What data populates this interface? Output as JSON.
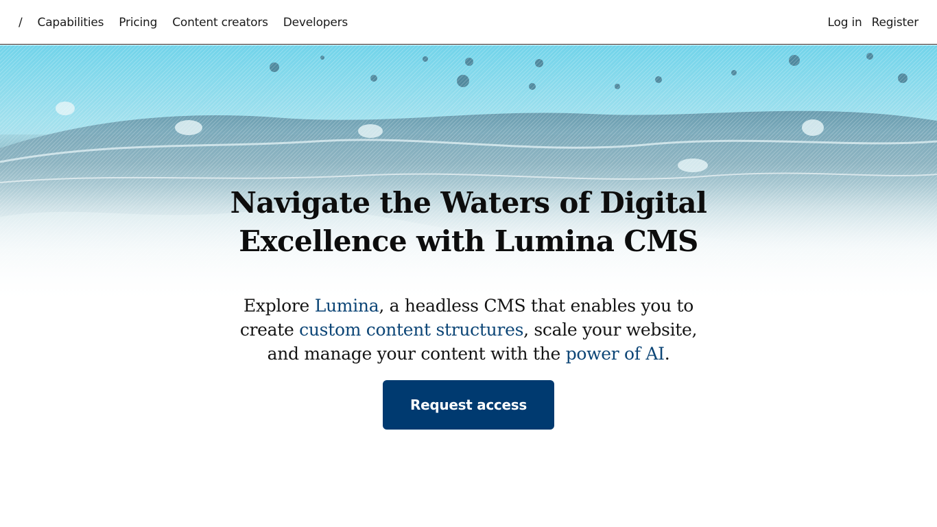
{
  "nav": {
    "home_label": "/",
    "links": [
      "Capabilities",
      "Pricing",
      "Content creators",
      "Developers"
    ],
    "login_label": "Log in",
    "register_label": "Register"
  },
  "hero": {
    "headline": "Navigate the Waters of Digital Excellence with Lumina CMS",
    "subtitle": {
      "part1": "Explore ",
      "hl1": "Lumina",
      "part2": ", a headless CMS that enables you to create ",
      "hl2": "custom content structures",
      "part3": ", scale your website, and manage your content with the ",
      "hl3": "power of AI",
      "part4": "."
    },
    "cta_label": "Request access",
    "background_image": "water-splash-image"
  },
  "colors": {
    "accent": "#003a70",
    "link_highlight": "#0c4576"
  }
}
